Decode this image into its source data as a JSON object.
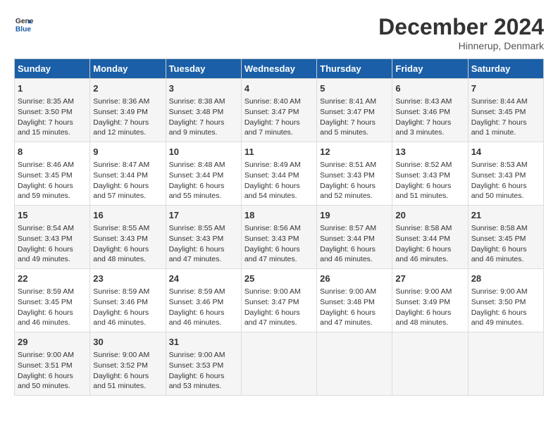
{
  "header": {
    "logo_line1": "General",
    "logo_line2": "Blue",
    "month_title": "December 2024",
    "location": "Hinnerup, Denmark"
  },
  "days_of_week": [
    "Sunday",
    "Monday",
    "Tuesday",
    "Wednesday",
    "Thursday",
    "Friday",
    "Saturday"
  ],
  "weeks": [
    [
      {
        "day": "1",
        "sunrise": "8:35 AM",
        "sunset": "3:50 PM",
        "daylight": "7 hours and 15 minutes."
      },
      {
        "day": "2",
        "sunrise": "8:36 AM",
        "sunset": "3:49 PM",
        "daylight": "7 hours and 12 minutes."
      },
      {
        "day": "3",
        "sunrise": "8:38 AM",
        "sunset": "3:48 PM",
        "daylight": "7 hours and 9 minutes."
      },
      {
        "day": "4",
        "sunrise": "8:40 AM",
        "sunset": "3:47 PM",
        "daylight": "7 hours and 7 minutes."
      },
      {
        "day": "5",
        "sunrise": "8:41 AM",
        "sunset": "3:47 PM",
        "daylight": "7 hours and 5 minutes."
      },
      {
        "day": "6",
        "sunrise": "8:43 AM",
        "sunset": "3:46 PM",
        "daylight": "7 hours and 3 minutes."
      },
      {
        "day": "7",
        "sunrise": "8:44 AM",
        "sunset": "3:45 PM",
        "daylight": "7 hours and 1 minute."
      }
    ],
    [
      {
        "day": "8",
        "sunrise": "8:46 AM",
        "sunset": "3:45 PM",
        "daylight": "6 hours and 59 minutes."
      },
      {
        "day": "9",
        "sunrise": "8:47 AM",
        "sunset": "3:44 PM",
        "daylight": "6 hours and 57 minutes."
      },
      {
        "day": "10",
        "sunrise": "8:48 AM",
        "sunset": "3:44 PM",
        "daylight": "6 hours and 55 minutes."
      },
      {
        "day": "11",
        "sunrise": "8:49 AM",
        "sunset": "3:44 PM",
        "daylight": "6 hours and 54 minutes."
      },
      {
        "day": "12",
        "sunrise": "8:51 AM",
        "sunset": "3:43 PM",
        "daylight": "6 hours and 52 minutes."
      },
      {
        "day": "13",
        "sunrise": "8:52 AM",
        "sunset": "3:43 PM",
        "daylight": "6 hours and 51 minutes."
      },
      {
        "day": "14",
        "sunrise": "8:53 AM",
        "sunset": "3:43 PM",
        "daylight": "6 hours and 50 minutes."
      }
    ],
    [
      {
        "day": "15",
        "sunrise": "8:54 AM",
        "sunset": "3:43 PM",
        "daylight": "6 hours and 49 minutes."
      },
      {
        "day": "16",
        "sunrise": "8:55 AM",
        "sunset": "3:43 PM",
        "daylight": "6 hours and 48 minutes."
      },
      {
        "day": "17",
        "sunrise": "8:55 AM",
        "sunset": "3:43 PM",
        "daylight": "6 hours and 47 minutes."
      },
      {
        "day": "18",
        "sunrise": "8:56 AM",
        "sunset": "3:43 PM",
        "daylight": "6 hours and 47 minutes."
      },
      {
        "day": "19",
        "sunrise": "8:57 AM",
        "sunset": "3:44 PM",
        "daylight": "6 hours and 46 minutes."
      },
      {
        "day": "20",
        "sunrise": "8:58 AM",
        "sunset": "3:44 PM",
        "daylight": "6 hours and 46 minutes."
      },
      {
        "day": "21",
        "sunrise": "8:58 AM",
        "sunset": "3:45 PM",
        "daylight": "6 hours and 46 minutes."
      }
    ],
    [
      {
        "day": "22",
        "sunrise": "8:59 AM",
        "sunset": "3:45 PM",
        "daylight": "6 hours and 46 minutes."
      },
      {
        "day": "23",
        "sunrise": "8:59 AM",
        "sunset": "3:46 PM",
        "daylight": "6 hours and 46 minutes."
      },
      {
        "day": "24",
        "sunrise": "8:59 AM",
        "sunset": "3:46 PM",
        "daylight": "6 hours and 46 minutes."
      },
      {
        "day": "25",
        "sunrise": "9:00 AM",
        "sunset": "3:47 PM",
        "daylight": "6 hours and 47 minutes."
      },
      {
        "day": "26",
        "sunrise": "9:00 AM",
        "sunset": "3:48 PM",
        "daylight": "6 hours and 47 minutes."
      },
      {
        "day": "27",
        "sunrise": "9:00 AM",
        "sunset": "3:49 PM",
        "daylight": "6 hours and 48 minutes."
      },
      {
        "day": "28",
        "sunrise": "9:00 AM",
        "sunset": "3:50 PM",
        "daylight": "6 hours and 49 minutes."
      }
    ],
    [
      {
        "day": "29",
        "sunrise": "9:00 AM",
        "sunset": "3:51 PM",
        "daylight": "6 hours and 50 minutes."
      },
      {
        "day": "30",
        "sunrise": "9:00 AM",
        "sunset": "3:52 PM",
        "daylight": "6 hours and 51 minutes."
      },
      {
        "day": "31",
        "sunrise": "9:00 AM",
        "sunset": "3:53 PM",
        "daylight": "6 hours and 53 minutes."
      },
      null,
      null,
      null,
      null
    ]
  ],
  "labels": {
    "sunrise": "Sunrise:",
    "sunset": "Sunset:",
    "daylight": "Daylight:"
  }
}
